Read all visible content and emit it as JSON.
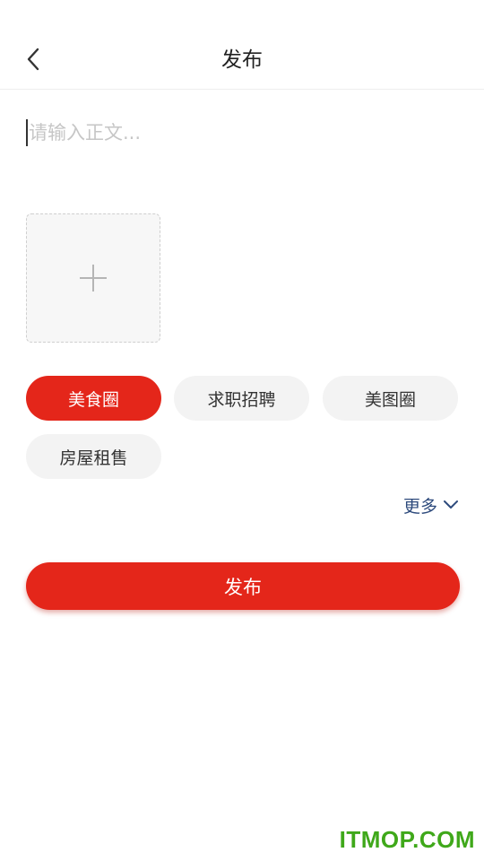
{
  "header": {
    "title": "发布",
    "back_icon": "chevron-left-icon"
  },
  "editor": {
    "placeholder": "请输入正文..."
  },
  "image_picker": {
    "icon": "plus-icon"
  },
  "tags": [
    {
      "label": "美食圈",
      "selected": true
    },
    {
      "label": "求职招聘",
      "selected": false
    },
    {
      "label": "美图圈",
      "selected": false
    },
    {
      "label": "房屋租售",
      "selected": false
    }
  ],
  "more": {
    "label": "更多",
    "icon": "chevron-down-icon"
  },
  "submit": {
    "label": "发布"
  },
  "watermark": {
    "text": "ITMOP.COM"
  },
  "colors": {
    "accent": "#e4261a",
    "tag_bg": "#f3f3f3",
    "more_link": "#2d4a7c",
    "watermark": "#3fa81a"
  }
}
